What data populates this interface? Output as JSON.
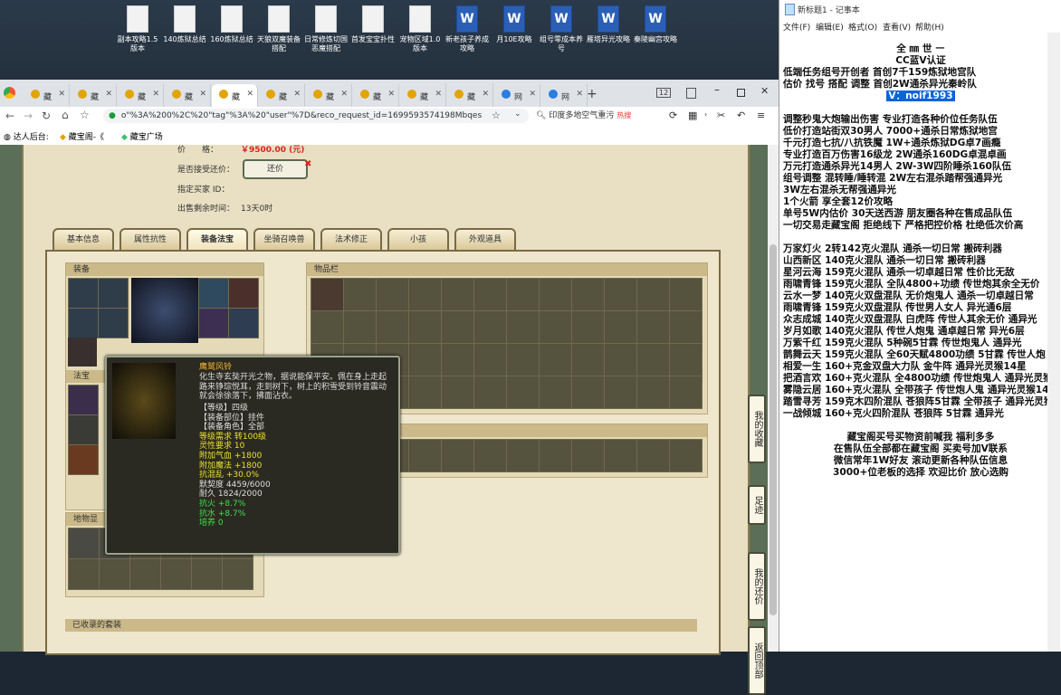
{
  "desktop": {
    "icons": [
      {
        "label": "副本攻略1.5版本",
        "type": "doc"
      },
      {
        "label": "140炼狱总结",
        "type": "doc"
      },
      {
        "label": "160炼狱总结",
        "type": "doc"
      },
      {
        "label": "天狼双魔装备搭配",
        "type": "doc"
      },
      {
        "label": "日常修炼切国恶魔搭配",
        "type": "doc"
      },
      {
        "label": "首发宝宝扑性",
        "type": "doc"
      },
      {
        "label": "宠物区域1.0版本",
        "type": "doc"
      },
      {
        "label": "新老孩子养成攻略",
        "type": "word"
      },
      {
        "label": "月10E攻略",
        "type": "word"
      },
      {
        "label": "组号零成本养号",
        "type": "word"
      },
      {
        "label": "雁塔异光攻略",
        "type": "word"
      },
      {
        "label": "秦陵幽宫攻略",
        "type": "word"
      }
    ]
  },
  "browser": {
    "tabs": [
      {
        "label": "藏"
      },
      {
        "label": "藏"
      },
      {
        "label": "藏"
      },
      {
        "label": "藏"
      },
      {
        "label": "藏",
        "active": true
      },
      {
        "label": "藏"
      },
      {
        "label": "藏"
      },
      {
        "label": "藏"
      },
      {
        "label": "藏"
      },
      {
        "label": "藏"
      },
      {
        "label": "网"
      },
      {
        "label": "网"
      }
    ],
    "tab_count": "12",
    "url": "o\"%3A%200%2C%20\"tag\"%3A%20\"user\"%7D&reco_request_id=1699593574198Mbqes",
    "search_text": "印度多地空气重污",
    "search_badge": "热搜",
    "bookmarks": [
      "达人后台:",
      "藏宝阁-《",
      "藏宝广场"
    ]
  },
  "listing": {
    "price_label": "价　　格：",
    "price_value": "￥9500.00 (元)",
    "counter_label": "是否接受还价：",
    "counter_button": "还价",
    "buyer_label": "指定买家 ID：",
    "remaining_label": "出售剩余时间：",
    "remaining_value": "13天0时"
  },
  "tabs": [
    "基本信息",
    "属性抗性",
    "装备法宝",
    "坐骑召唤兽",
    "法术修正",
    "小孩",
    "外观道具"
  ],
  "sections": {
    "equipment": "装备",
    "inventory": "物品栏",
    "fabao": "法宝",
    "mount": "地物显",
    "collected": "已收录的套装"
  },
  "side_buttons": [
    "我的收藏",
    "足迹",
    "我的还价",
    "返回顶部"
  ],
  "tooltip": {
    "name": "鹰鹫风铃",
    "desc": "化生寺玄奘开光之物，据说能保平安。佩在身上走起路来铮琮悦耳，走到树下，树上的积雪受到铃音震动就会徐徐落下，拂面沾衣。",
    "lines": [
      {
        "text": "【等级】四级",
        "color": "#ddd"
      },
      {
        "text": "【装备部位】挂件",
        "color": "#ddd"
      },
      {
        "text": "【装备角色】全部",
        "color": "#ddd"
      },
      {
        "text": "等级需求 转100级",
        "color": "#e8e02a"
      },
      {
        "text": "灵性要求 10",
        "color": "#e8e02a"
      },
      {
        "text": "附加气血 +1800",
        "color": "#e8e02a"
      },
      {
        "text": "附加魔法 +1800",
        "color": "#e8e02a"
      },
      {
        "text": "抗混乱 +30.0%",
        "color": "#e8e02a"
      },
      {
        "text": "默契度 4459/6000",
        "color": "#ddd"
      },
      {
        "text": "耐久 1824/2000",
        "color": "#ddd"
      },
      {
        "text": "抗火 +8.7%",
        "color": "#3fe04a"
      },
      {
        "text": "抗水 +8.7%",
        "color": "#3fe04a"
      },
      {
        "text": "培养 0",
        "color": "#3fe04a"
      }
    ]
  },
  "notepad": {
    "title": "新标题1 - 记事本",
    "menu": [
      "文件(F)",
      "编辑(E)",
      "格式(O)",
      "查看(V)",
      "帮助(H)"
    ],
    "lines": [
      "全    ㎜ 世  ㇐",
      "CC蓝V认证",
      "低端任务组号开创者       首创7千159炼狱地宫队",
      "估价 找号 搭配 调整       首创2W通杀异光秦岭队",
      "V：noif1993",
      "",
      "调整秒鬼大炮输出伤害         专业打造各种价位任务队伍",
      "低价打造站街双30男人          7000+通杀日常炼狱地宫",
      "千元打造七抗/八抗铁魔          1W+通杀炼狱DG卓7画瘾",
      "专业打造百万伤害16级龙         2W通杀160DG卓混卓画",
      "万元打造通杀异光14男人         2W-3W四阶睡杀160队伍",
      "组号调整 混转睡/睡转混          2W左右混杀踏帮强通异光",
      "                                  3W左右混杀无帮强通异光",
      "1个火箭 享全套12价攻略",
      "单号5W内估价 30天送西游       朋友圈各种在售成品队伍",
      "一切交易走藏宝阁 拒绝线下    严格把控价格 杜绝低次价高",
      "",
      "万家灯火 2转142克火混队 通杀一切日常 搬砖利器",
      "山西新区 140克火混队 通杀一切日常 搬砖利器",
      "星河云海 159克火混队 通杀一切卓越日常 性价比无敌",
      "雨啸青锋 159克火混队 全队4800+功绩 传世炮其余全无价",
      "云水一梦 140克火双盘混队 无价炮鬼人 通杀一切卓越日常",
      "雨啸青锋 159克火双盘混队 传世男人女人 异光通6层",
      "众志成城 140克火双盘混队 白虎阵 传世人其余无价 通异光",
      "岁月如歌 140克火混队 传世人炮鬼 通卓越日常 异光6层",
      "万紫千红 159克火混队 5种碗5甘霖 传世炮鬼人 通异光",
      "鹊舞云天 159克火混队 全60天赋4800功绩 5甘霖 传世人炮",
      "相爱一生 160+克金双盘大力队 金牛阵 通异光灵猴14星",
      "把酒言欢 160+克火混队 全4800功绩 传世炮鬼人 通异光灵猴",
      "雾隐云居 160+克火混队 全带孩子 传世炮人鬼 通异光灵猴14",
      "踏雪寻芳 159克木四阶混队 苍狼阵5甘霖 全带孩子 通异光灵猴",
      "一战倾城 160+克火四阶混队 苍狼阵 5甘霖 通异光",
      "",
      "藏宝阁买号买物资前喊我 福利多多",
      "在售队伍全部都在藏宝阁 买卖号加V联系",
      "微信常年1W好友 滚动更新各种队伍信息",
      "3000+位老板的选择 欢迎比价 放心选购"
    ]
  }
}
